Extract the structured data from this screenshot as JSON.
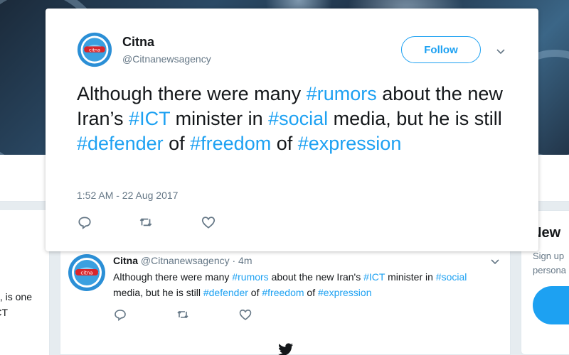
{
  "tweet": {
    "display_name": "Citna",
    "handle": "@Citnanewsagency",
    "follow_label": "Follow",
    "avatar_text": "citna",
    "text_segments": [
      {
        "text": "Although there were many ",
        "tag": false
      },
      {
        "text": "#rumors",
        "tag": true
      },
      {
        "text": " about the new Iran’s ",
        "tag": false
      },
      {
        "text": "#ICT",
        "tag": true
      },
      {
        "text": " minister in ",
        "tag": false
      },
      {
        "text": "#social",
        "tag": true
      },
      {
        "text": " media, but he is still ",
        "tag": false
      },
      {
        "text": "#defender",
        "tag": true
      },
      {
        "text": " of ",
        "tag": false
      },
      {
        "text": "#freedom",
        "tag": true
      },
      {
        "text": " of ",
        "tag": false
      },
      {
        "text": "#expression",
        "tag": true
      }
    ],
    "timestamp": "1:52 AM - 22 Aug 2017",
    "actions": [
      "reply-icon",
      "retweet-icon",
      "like-icon"
    ]
  },
  "feed_tweet": {
    "display_name": "Citna",
    "meta": "@Citnanewsagency · 4m",
    "text_segments": [
      {
        "text": "Although there were many ",
        "tag": false
      },
      {
        "text": "#rumors",
        "tag": true
      },
      {
        "text": " about the new Iran's ",
        "tag": false
      },
      {
        "text": "#ICT",
        "tag": true
      },
      {
        "text": " minister in ",
        "tag": false
      },
      {
        "text": "#social",
        "tag": true
      },
      {
        "text": " media, but he is still ",
        "tag": false
      },
      {
        "text": "#defender",
        "tag": true
      },
      {
        "text": " of ",
        "tag": false
      },
      {
        "text": "#freedom",
        "tag": true
      },
      {
        "text": " of ",
        "tag": false
      },
      {
        "text": "#expression",
        "tag": true
      }
    ]
  },
  "left_card": {
    "line1": ", is one",
    "line2": "CT"
  },
  "right_card": {
    "title": "New",
    "line1": "Sign up",
    "line2": "persona"
  },
  "colors": {
    "accent": "#1da1f2",
    "text": "#14171a",
    "muted": "#657786",
    "background": "#e6ecf0"
  }
}
